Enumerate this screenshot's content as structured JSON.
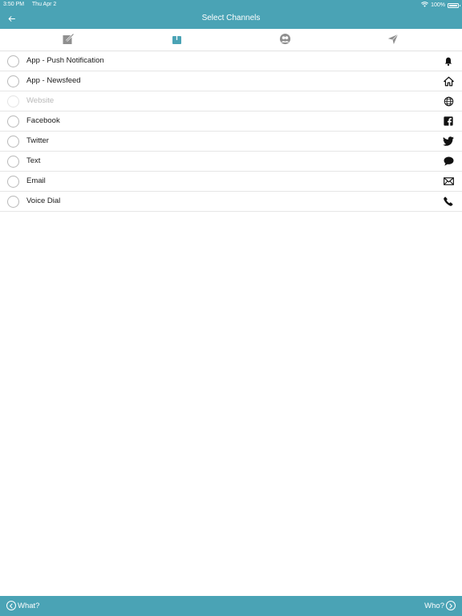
{
  "status": {
    "time": "3:50 PM",
    "date": "Thu Apr 2",
    "battery": "100%",
    "battery_level": 1.0
  },
  "header": {
    "title": "Select Channels",
    "back_icon": "arrow-left-icon"
  },
  "tabs": [
    {
      "icon": "compose-icon",
      "active": false
    },
    {
      "icon": "share-icon",
      "active": true
    },
    {
      "icon": "audience-icon",
      "active": false
    },
    {
      "icon": "send-icon",
      "active": false
    }
  ],
  "colors": {
    "accent": "#4aa3b5",
    "tab_inactive": "#8f8f8f",
    "disabled_text": "#b8b8b8"
  },
  "channels": [
    {
      "label": "App - Push Notification",
      "icon": "bell-icon",
      "enabled": true
    },
    {
      "label": "App - Newsfeed",
      "icon": "home-icon",
      "enabled": true
    },
    {
      "label": "Website",
      "icon": "globe-icon",
      "enabled": false
    },
    {
      "label": "Facebook",
      "icon": "facebook-icon",
      "enabled": true
    },
    {
      "label": "Twitter",
      "icon": "twitter-icon",
      "enabled": true
    },
    {
      "label": "Text",
      "icon": "chat-bubble-icon",
      "enabled": true
    },
    {
      "label": "Email",
      "icon": "envelope-icon",
      "enabled": true
    },
    {
      "label": "Voice Dial",
      "icon": "phone-icon",
      "enabled": true
    }
  ],
  "footer": {
    "prev_label": "What?",
    "next_label": "Who?"
  }
}
